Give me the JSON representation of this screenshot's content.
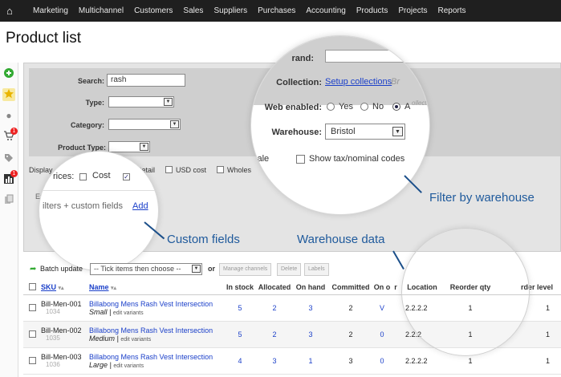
{
  "nav": {
    "items": [
      "Marketing",
      "Multichannel",
      "Customers",
      "Sales",
      "Suppliers",
      "Purchases",
      "Accounting",
      "Products",
      "Projects",
      "Reports"
    ]
  },
  "page": {
    "title": "Product list"
  },
  "sidebar": {
    "badges": [
      "1",
      "1"
    ]
  },
  "filters": {
    "search_label": "Search:",
    "search_value": "rash",
    "type_label": "Type:",
    "category_label": "Category:",
    "product_type_label": "Product Type:",
    "display_label": "Display",
    "cost_label": "Cost",
    "retail_label": "Retail",
    "usd_cost_label": "USD cost",
    "wholesale_label": "Wholes",
    "ex_label": "Ex",
    "custom_fields_text": "ilters + custom fields",
    "add_link": "Add",
    "brand_label": "rand:",
    "collection_label": "Collection:",
    "collection_link": "Setup collections",
    "collection_tail": "Br",
    "web_enabled_label": "Web enabled:",
    "yes_label": "Yes",
    "no_label": "No",
    "all_label": "A",
    "collections_text": "ollections",
    "warehouse_label": "Warehouse:",
    "warehouse_value": "Bristol",
    "sale_text": "sale",
    "show_tax_label": "Show tax/nominal codes",
    "prices_text": "rices:",
    "er_link": "er"
  },
  "callouts": {
    "filter_by_warehouse": "Filter by warehouse",
    "custom_fields": "Custom fields",
    "warehouse_data": "Warehouse data"
  },
  "toolbar": {
    "batch_update": "Batch update",
    "tick_placeholder": "-- Tick items then choose --",
    "or": "or",
    "manage_channels": "Manage channels",
    "delete": "Delete",
    "labels": "Labels"
  },
  "table": {
    "headers": {
      "sku": "SKU",
      "name": "Name",
      "in_stock": "In stock",
      "allocated": "Allocated",
      "on_hand": "On hand",
      "committed": "Committed",
      "on_order": "On o",
      "location": "Location",
      "reorder_qty": "Reorder qty",
      "reorder_level": "rder level",
      "r": "r"
    },
    "rows": [
      {
        "sku": "Bill-Men-001",
        "code": "1034",
        "name": "Billabong Mens Rash Vest Intersection",
        "variant": "Small",
        "variant_link": "edit variants",
        "in_stock": "5",
        "allocated": "2",
        "on_hand": "3",
        "committed": "2",
        "on_order": "V",
        "location": "2.2.2.2",
        "reorder_qty": "1",
        "reorder_level": "1"
      },
      {
        "sku": "Bill-Men-002",
        "code": "1035",
        "name": "Billabong Mens Rash Vest Intersection",
        "variant": "Medium",
        "variant_link": "edit variants",
        "in_stock": "5",
        "allocated": "2",
        "on_hand": "3",
        "committed": "2",
        "on_order": "0",
        "location": "2.2.2",
        "reorder_qty": "1",
        "reorder_level": "1"
      },
      {
        "sku": "Bill-Men-003",
        "code": "1036",
        "name": "Billabong Mens Rash Vest Intersection",
        "variant": "Large",
        "variant_link": "edit variants",
        "in_stock": "4",
        "allocated": "3",
        "on_hand": "1",
        "committed": "3",
        "on_order": "0",
        "location": "2.2.2.2",
        "reorder_qty": "1",
        "reorder_level": "1"
      }
    ]
  }
}
